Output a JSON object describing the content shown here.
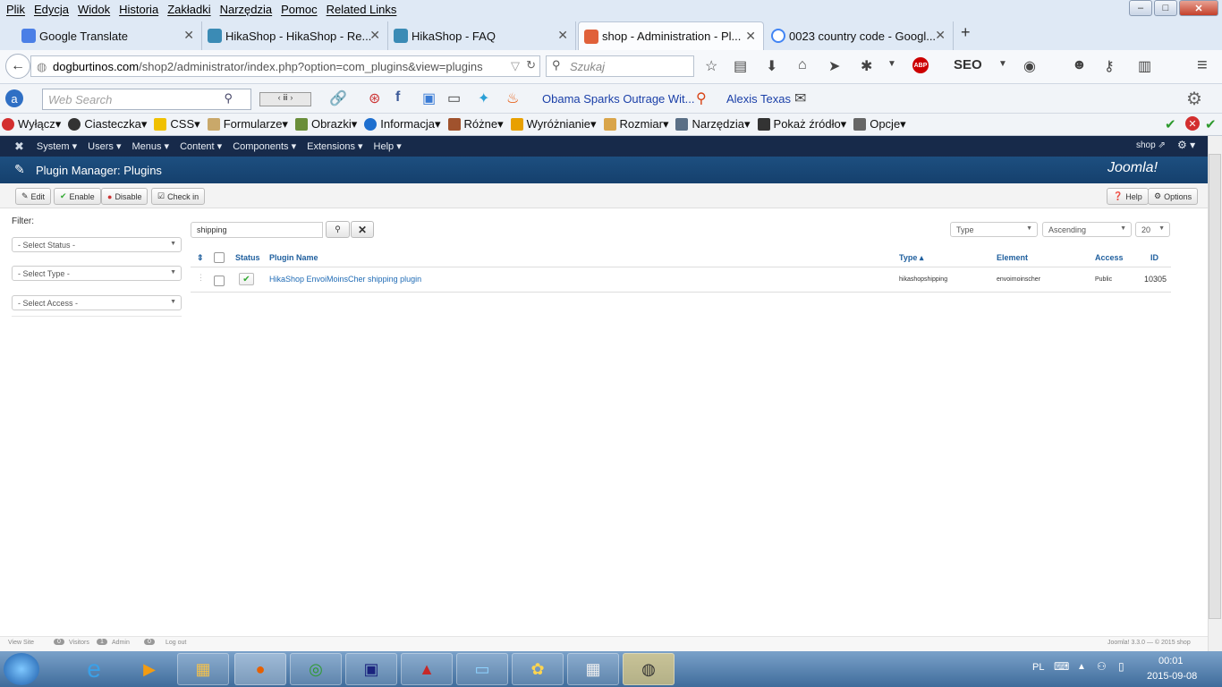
{
  "menubar": {
    "items": [
      "Plik",
      "Edycja",
      "Widok",
      "Historia",
      "Zakładki",
      "Narzędzia",
      "Pomoc",
      "Related Links"
    ]
  },
  "window_buttons": {
    "minimize": "–",
    "maximize": "□",
    "close": "✕"
  },
  "tabs": [
    {
      "label": "Google Translate",
      "color": "#4b7fe6"
    },
    {
      "label": "HikaShop - HikaShop - Re...",
      "color": "#3b8bb5"
    },
    {
      "label": "HikaShop - FAQ",
      "color": "#3b8bb5"
    },
    {
      "label": "shop - Administration - Pl...",
      "color": "#e0613a",
      "active": true
    },
    {
      "label": "0023 country code - Googl...",
      "color": "#4285f4"
    }
  ],
  "new_tab": "+",
  "navbar": {
    "url_host": "dogburtinos.com",
    "url_path": "/shop2/administrator/index.php?option=com_plugins&view=plugins",
    "search_placeholder": "Szukaj",
    "seo": "SEO"
  },
  "bar2": {
    "websearch_placeholder": "Web Search",
    "news_link": "Obama Sparks Outrage Wit...",
    "person_link": "Alexis Texas"
  },
  "bar3": {
    "items": [
      "Wyłącz▾",
      "Ciasteczka▾",
      "CSS▾",
      "Formularze▾",
      "Obrazki▾",
      "Informacja▾",
      "Różne▾",
      "Wyróżnianie▾",
      "Rozmiar▾",
      "Narzędzia▾",
      "Pokaż źródło▾",
      "Opcje▾"
    ]
  },
  "joomla": {
    "nav": [
      "System ▾",
      "Users ▾",
      "Menus ▾",
      "Content ▾",
      "Components ▾",
      "Extensions ▾",
      "Help ▾"
    ],
    "shop_link": "shop ⇗",
    "page_title": "Plugin Manager: Plugins",
    "brand": "Joomla!",
    "toolbar": {
      "edit": "Edit",
      "enable": "Enable",
      "disable": "Disable",
      "checkin": "Check in",
      "help": "Help",
      "options": "Options"
    },
    "filter_label": "Filter:",
    "filters": [
      "- Select Status -",
      "- Select Type -",
      "- Select Access -"
    ],
    "search_value": "shipping",
    "sort": {
      "type": "Type",
      "order": "Ascending",
      "limit": "20"
    },
    "columns": {
      "status": "Status",
      "name": "Plugin Name",
      "type": "Type ▴",
      "element": "Element",
      "access": "Access",
      "id": "ID"
    },
    "rows": [
      {
        "name": "HikaShop EnvoiMoinsCher shipping plugin",
        "type": "hikashopshipping",
        "element": "envoimoinscher",
        "access": "Public",
        "id": "10305"
      }
    ],
    "footer_left": [
      "View Site",
      "0",
      "Visitors",
      "1",
      "Admin",
      "0",
      "Log out"
    ],
    "footer_right": "Joomla! 3.3.0 — © 2015 shop"
  },
  "taskbar": {
    "lang": "PL",
    "time": "00:01",
    "date": "2015-09-08"
  }
}
